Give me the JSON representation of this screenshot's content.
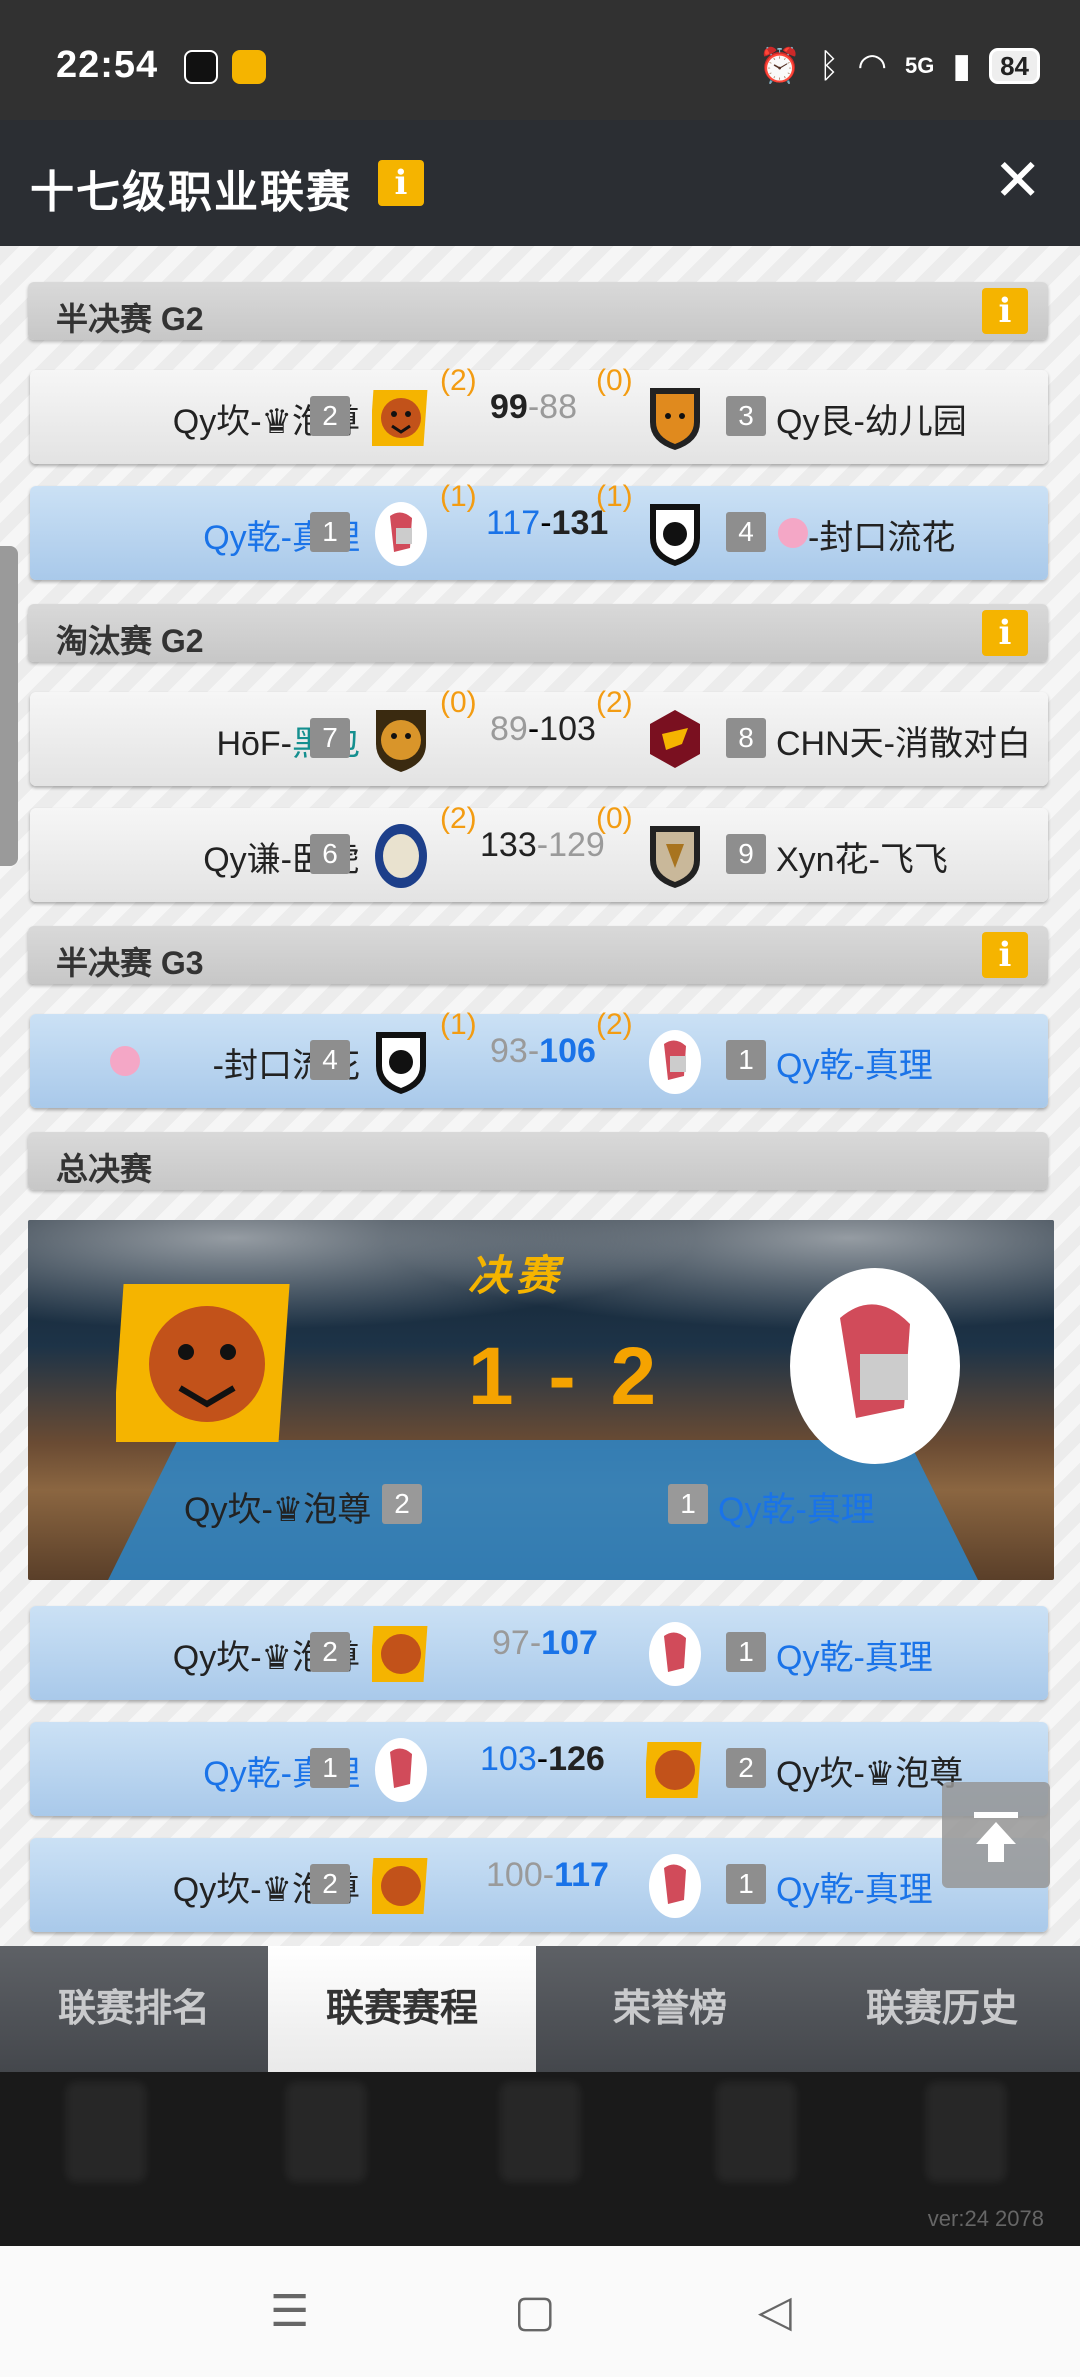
{
  "status": {
    "time": "22:54",
    "signal": "5G",
    "battery": "84"
  },
  "header": {
    "title": "十七级职业联赛",
    "info": "i",
    "close": "✕"
  },
  "sections": {
    "semi_g2": "半决赛 G2",
    "elim_g2": "淘汰赛 G2",
    "semi_g3": "半决赛 G3",
    "final": "总决赛"
  },
  "matches": [
    {
      "left": "Qy坎-♛泡尊",
      "lseed": "2",
      "lwins": "(2)",
      "lscore": "99",
      "rscore": "88",
      "rwins": "(0)",
      "rseed": "3",
      "right": "Qy艮-幼儿园"
    },
    {
      "left": "Qy乾-真理",
      "lseed": "1",
      "lwins": "(1)",
      "lscore": "117",
      "rscore": "131",
      "rwins": "(1)",
      "rseed": "4",
      "right": "-封口流花"
    },
    {
      "left_a": "HōF-",
      "left_b": "黑包",
      "lseed": "7",
      "lwins": "(0)",
      "lscore": "89",
      "rscore": "103",
      "rwins": "(2)",
      "rseed": "8",
      "right": "CHN天-消散对白"
    },
    {
      "left": "Qy谦-卧虎",
      "lseed": "6",
      "lwins": "(2)",
      "lscore": "133",
      "rscore": "129",
      "rwins": "(0)",
      "rseed": "9",
      "right": "Xyn花-飞飞"
    },
    {
      "left": "-封口流花",
      "lseed": "4",
      "lwins": "(1)",
      "lscore": "93",
      "rscore": "106",
      "rwins": "(2)",
      "rseed": "1",
      "right": "Qy乾-真理"
    }
  ],
  "final": {
    "title": "决赛",
    "score": "1 - 2",
    "left": "Qy坎-♛泡尊",
    "lseed": "2",
    "right": "Qy乾-真理",
    "rseed": "1",
    "games": [
      {
        "left": "Qy坎-♛泡尊",
        "lseed": "2",
        "lscore": "97",
        "rscore": "107",
        "rseed": "1",
        "right": "Qy乾-真理"
      },
      {
        "left": "Qy乾-真理",
        "lseed": "1",
        "lscore": "103",
        "rscore": "126",
        "rseed": "2",
        "right": "Qy坎-♛泡尊"
      },
      {
        "left": "Qy坎-♛泡尊",
        "lseed": "2",
        "lscore": "100",
        "rscore": "117",
        "rseed": "1",
        "right": "Qy乾-真理"
      }
    ]
  },
  "tabs": [
    "联赛排名",
    "联赛赛程",
    "荣誉榜",
    "联赛历史"
  ],
  "version": "ver:24  2078",
  "colors": {
    "accent": "#f5b400",
    "blue": "#1a73e8",
    "header": "#2b2e33"
  }
}
